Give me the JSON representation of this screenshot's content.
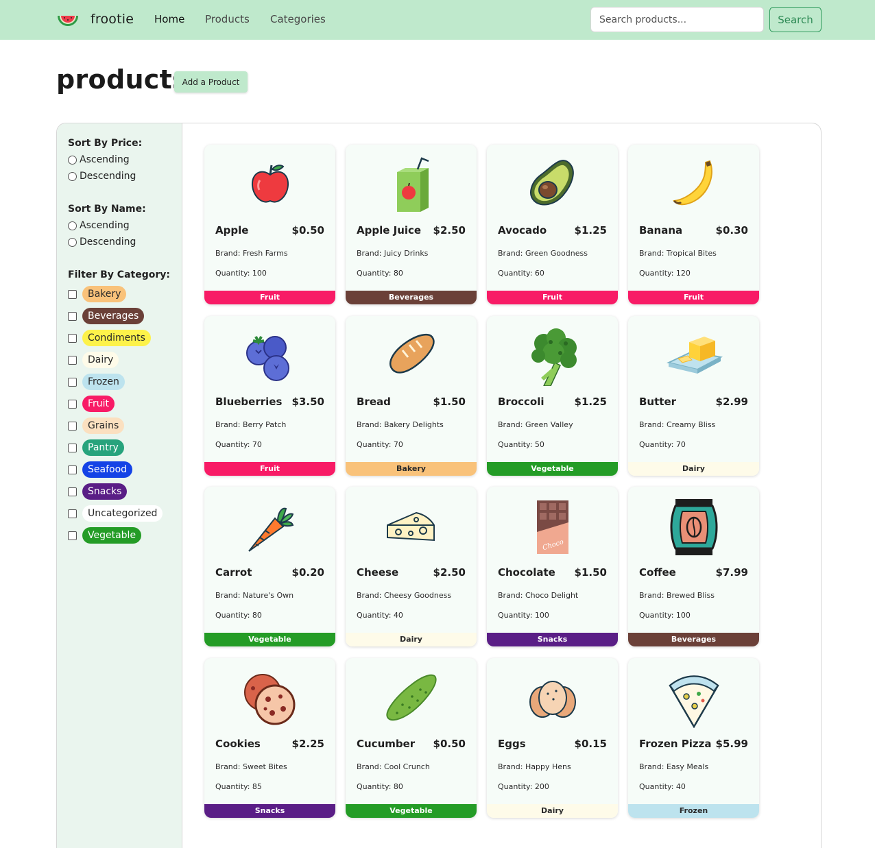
{
  "nav": {
    "brand": "frootie",
    "links": [
      "Home",
      "Products",
      "Categories"
    ],
    "search_placeholder": "Search products...",
    "search_button": "Search"
  },
  "header": {
    "title": "products",
    "add_button": "Add a Product"
  },
  "sidebar": {
    "sort_price": {
      "title": "Sort By Price:",
      "options": [
        "Ascending",
        "Descending"
      ]
    },
    "sort_name": {
      "title": "Sort By Name:",
      "options": [
        "Ascending",
        "Descending"
      ]
    },
    "filter": {
      "title": "Filter By Category:",
      "categories": [
        {
          "label": "Bakery",
          "bg": "#f9c27a",
          "fg": "#2a2a2a"
        },
        {
          "label": "Beverages",
          "bg": "#6b4038",
          "fg": "#ffffff"
        },
        {
          "label": "Condiments",
          "bg": "#fdf24a",
          "fg": "#2a2a2a"
        },
        {
          "label": "Dairy",
          "bg": "#fefbe9",
          "fg": "#2a2a2a"
        },
        {
          "label": "Frozen",
          "bg": "#bde3ee",
          "fg": "#2a2a2a"
        },
        {
          "label": "Fruit",
          "bg": "#f81b66",
          "fg": "#ffffff"
        },
        {
          "label": "Grains",
          "bg": "#fbe0c0",
          "fg": "#2a2a2a"
        },
        {
          "label": "Pantry",
          "bg": "#27a37c",
          "fg": "#ffffff"
        },
        {
          "label": "Seafood",
          "bg": "#1443e6",
          "fg": "#ffffff"
        },
        {
          "label": "Snacks",
          "bg": "#5a1e86",
          "fg": "#ffffff"
        },
        {
          "label": "Uncategorized",
          "bg": "#ffffff",
          "fg": "#2a2a2a"
        },
        {
          "label": "Vegetable",
          "bg": "#249c26",
          "fg": "#ffffff"
        }
      ]
    }
  },
  "colors": {
    "nav_bg": "#bfe9cc",
    "sidebar_bg": "#eaf5ee",
    "card_bg": "#f6fcf8",
    "Fruit": "#f81b66",
    "Beverages": "#6b4038",
    "Vegetable": "#249c26",
    "Bakery": "#f9c27a",
    "Dairy": "#fefbe9",
    "Snacks": "#5a1e86",
    "Frozen": "#bde3ee"
  },
  "products": [
    {
      "name": "Apple",
      "price": "$0.50",
      "brand": "Brand: Fresh Farms",
      "quantity": "Quantity: 100",
      "category": "Fruit",
      "icon": "apple-icon"
    },
    {
      "name": "Apple Juice",
      "price": "$2.50",
      "brand": "Brand: Juicy Drinks",
      "quantity": "Quantity: 80",
      "category": "Beverages",
      "icon": "juice-box-icon"
    },
    {
      "name": "Avocado",
      "price": "$1.25",
      "brand": "Brand: Green Goodness",
      "quantity": "Quantity: 60",
      "category": "Fruit",
      "icon": "avocado-icon"
    },
    {
      "name": "Banana",
      "price": "$0.30",
      "brand": "Brand: Tropical Bites",
      "quantity": "Quantity: 120",
      "category": "Fruit",
      "icon": "banana-icon"
    },
    {
      "name": "Blueberries",
      "price": "$3.50",
      "brand": "Brand: Berry Patch",
      "quantity": "Quantity: 70",
      "category": "Fruit",
      "icon": "blueberries-icon"
    },
    {
      "name": "Bread",
      "price": "$1.50",
      "brand": "Brand: Bakery Delights",
      "quantity": "Quantity: 70",
      "category": "Bakery",
      "icon": "bread-icon"
    },
    {
      "name": "Broccoli",
      "price": "$1.25",
      "brand": "Brand: Green Valley",
      "quantity": "Quantity: 50",
      "category": "Vegetable",
      "icon": "broccoli-icon"
    },
    {
      "name": "Butter",
      "price": "$2.99",
      "brand": "Brand: Creamy Bliss",
      "quantity": "Quantity: 70",
      "category": "Dairy",
      "icon": "butter-icon"
    },
    {
      "name": "Carrot",
      "price": "$0.20",
      "brand": "Brand: Nature's Own",
      "quantity": "Quantity: 80",
      "category": "Vegetable",
      "icon": "carrot-icon"
    },
    {
      "name": "Cheese",
      "price": "$2.50",
      "brand": "Brand: Cheesy Goodness",
      "quantity": "Quantity: 40",
      "category": "Dairy",
      "icon": "cheese-icon"
    },
    {
      "name": "Chocolate",
      "price": "$1.50",
      "brand": "Brand: Choco Delight",
      "quantity": "Quantity: 100",
      "category": "Snacks",
      "icon": "chocolate-icon",
      "icon_text": "Choco"
    },
    {
      "name": "Coffee",
      "price": "$7.99",
      "brand": "Brand: Brewed Bliss",
      "quantity": "Quantity: 100",
      "category": "Beverages",
      "icon": "coffee-bag-icon"
    },
    {
      "name": "Cookies",
      "price": "$2.25",
      "brand": "Brand: Sweet Bites",
      "quantity": "Quantity: 85",
      "category": "Snacks",
      "icon": "cookies-icon"
    },
    {
      "name": "Cucumber",
      "price": "$0.50",
      "brand": "Brand: Cool Crunch",
      "quantity": "Quantity: 80",
      "category": "Vegetable",
      "icon": "cucumber-icon"
    },
    {
      "name": "Eggs",
      "price": "$0.15",
      "brand": "Brand: Happy Hens",
      "quantity": "Quantity: 200",
      "category": "Dairy",
      "icon": "eggs-icon"
    },
    {
      "name": "Frozen Pizza",
      "price": "$5.99",
      "brand": "Brand: Easy Meals",
      "quantity": "Quantity: 40",
      "category": "Frozen",
      "icon": "pizza-slice-icon"
    }
  ]
}
